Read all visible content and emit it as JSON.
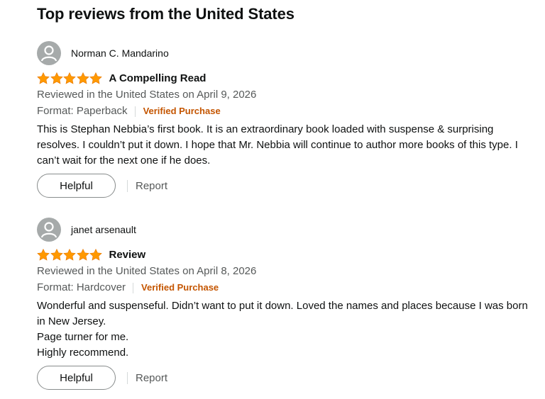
{
  "page_title": "Top reviews from the United States",
  "colors": {
    "star": "#ff9900",
    "verified": "#c45500",
    "muted": "#565959"
  },
  "reviews": [
    {
      "author": "Norman C. Mandarino",
      "rating": 5,
      "title": "A Compelling Read",
      "date": "Reviewed in the United States on April 9, 2026",
      "format": "Format: Paperback",
      "badge": "Verified Purchase",
      "body": "This is Stephan Nebbia’s first book. It is an extraordinary book loaded with suspense & surprising resolves. I couldn’t put it down. I hope that Mr. Nebbia will continue to author more books of this type. I can’t wait for the next one if he does.",
      "helpful_label": "Helpful",
      "report_label": "Report"
    },
    {
      "author": "janet arsenault",
      "rating": 5,
      "title": "Review",
      "date": "Reviewed in the United States on April 8, 2026",
      "format": "Format: Hardcover",
      "badge": "Verified Purchase",
      "body": "Wonderful and suspenseful. Didn’t want to put it down. Loved the names and places because I was born in New Jersey.\nPage turner for me.\nHighly recommend.",
      "helpful_label": "Helpful",
      "report_label": "Report"
    }
  ]
}
